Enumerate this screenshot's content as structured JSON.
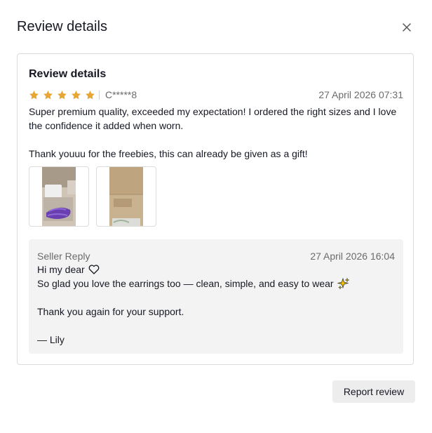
{
  "dialog": {
    "title": "Review details",
    "close_icon": "close-icon"
  },
  "review": {
    "heading": "Review details",
    "rating": 5,
    "rating_max": 5,
    "star_color": "#E8A531",
    "reviewer": "C*****8",
    "timestamp": "27 April 2026 07:31",
    "paragraphs": [
      "Super premium quality, exceeded my expectation! I ordered the right sizes and I love the confidence it added when worn.",
      "Thank youuu for the freebies, this can already be given as a gift!"
    ],
    "photos": [
      {
        "icon": "review-photo-1"
      },
      {
        "icon": "review-photo-2"
      }
    ]
  },
  "seller_reply": {
    "label": "Seller Reply",
    "timestamp": "27 April 2026 16:04",
    "lines": [
      "Hi my dear",
      "So glad you love the earrings too — clean, simple, and easy to wear",
      "Thank you again for your support.",
      "— Lily"
    ],
    "line_icons": [
      "heart-outline-icon",
      "sparkles-icon"
    ]
  },
  "actions": {
    "report_label": "Report review"
  }
}
